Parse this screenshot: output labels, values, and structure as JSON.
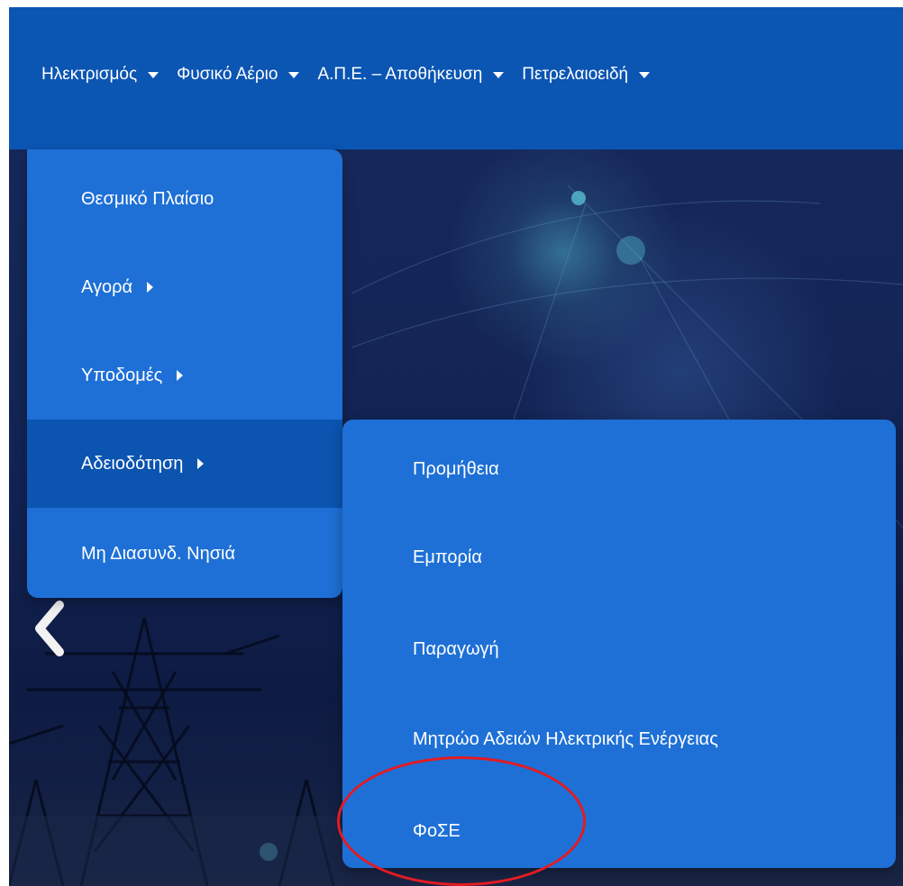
{
  "topnav": {
    "items": [
      {
        "label": "Ηλεκτρισμός"
      },
      {
        "label": "Φυσικό Αέριο"
      },
      {
        "label": "Α.Π.Ε. – Αποθήκευση"
      },
      {
        "label": "Πετρελαιοειδή"
      }
    ]
  },
  "menu": {
    "items": [
      {
        "label": "Θεσμικό Πλαίσιο"
      },
      {
        "label": "Αγορά"
      },
      {
        "label": "Υποδομές"
      },
      {
        "label": "Αδειοδότηση"
      },
      {
        "label": "Μη Διασυνδ. Νησιά"
      }
    ]
  },
  "submenu": {
    "items": [
      {
        "label": "Προμήθεια"
      },
      {
        "label": "Εμπορία"
      },
      {
        "label": "Παραγωγή"
      },
      {
        "label": "Μητρώο Αδειών Ηλεκτρικής Ενέργειας"
      },
      {
        "label": "ΦοΣΕ"
      }
    ]
  },
  "colors": {
    "nav_bg": "#0b55b3",
    "menu_bg": "#1e70d6",
    "menu_active": "#0b54b0",
    "annotation": "#e31b23"
  }
}
